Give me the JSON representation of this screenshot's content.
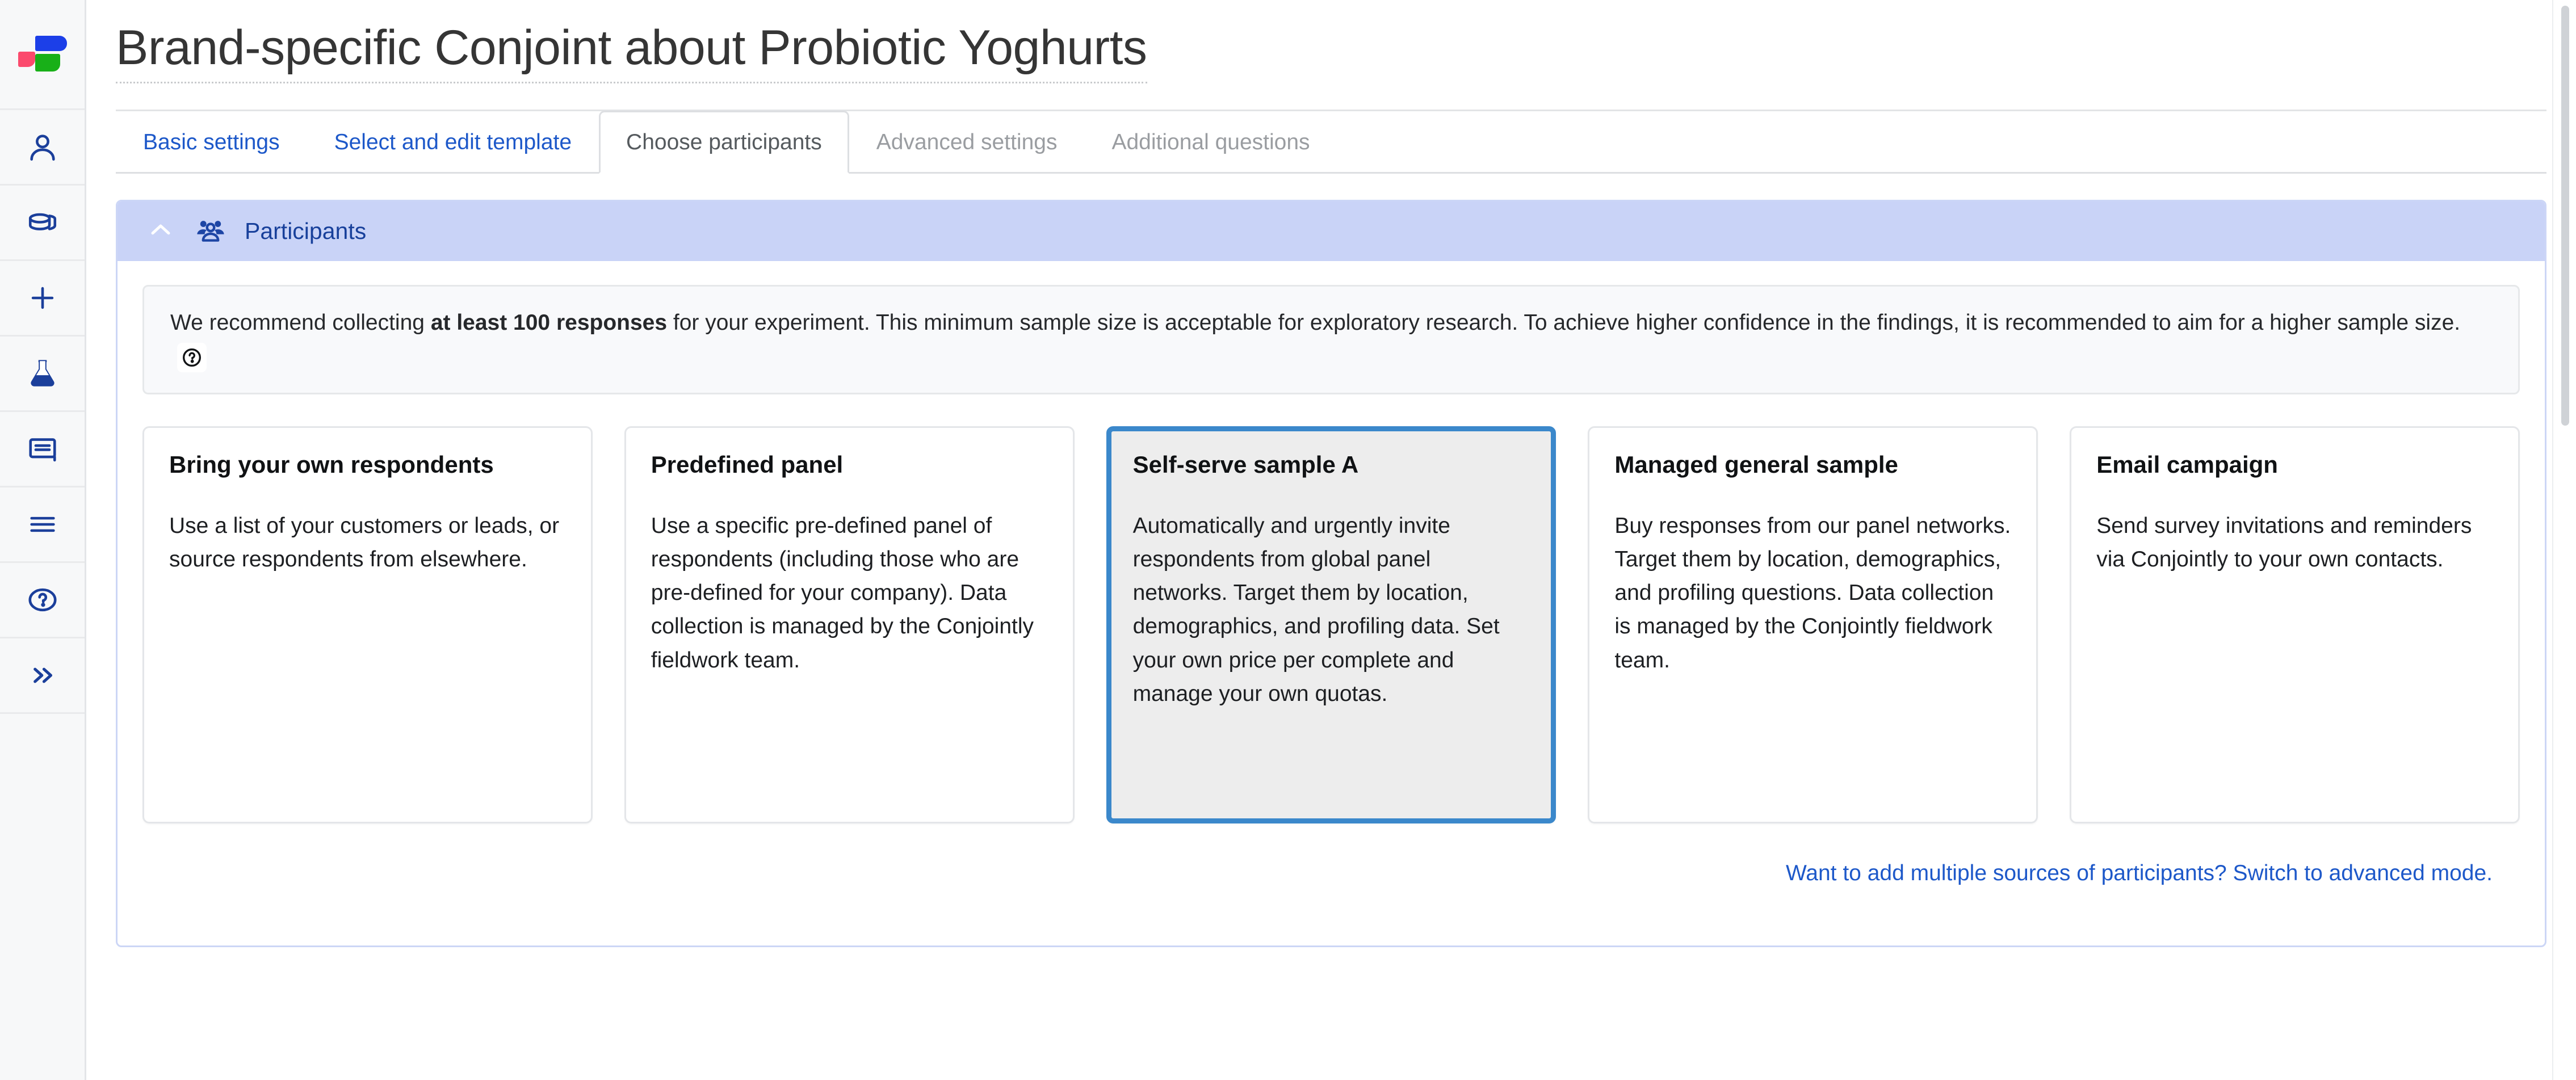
{
  "brand": {
    "logo_name": "conjointly-logo",
    "colors": {
      "blue": "#1c3fe8",
      "pink": "#fb4a6d",
      "green": "#18b018",
      "link": "#1d58c9",
      "selected_border": "#3b88cb",
      "panel_header_bg": "#c9d3f7"
    }
  },
  "sidebar": {
    "items": [
      {
        "icon": "user-icon",
        "label": "Account"
      },
      {
        "icon": "database-stack-icon",
        "label": "Projects"
      },
      {
        "icon": "plus-icon",
        "label": "New"
      },
      {
        "icon": "flask-icon",
        "label": "Experiments"
      },
      {
        "icon": "book-icon",
        "label": "Library"
      },
      {
        "icon": "hamburger-menu-icon",
        "label": "Menu"
      },
      {
        "icon": "question-circle-icon",
        "label": "Help"
      },
      {
        "icon": "chevrons-right-icon",
        "label": "Expand"
      }
    ]
  },
  "header": {
    "title": "Brand-specific Conjoint about Probiotic Yoghurts"
  },
  "tabs": [
    {
      "label": "Basic settings",
      "state": "link"
    },
    {
      "label": "Select and edit template",
      "state": "link"
    },
    {
      "label": "Choose participants",
      "state": "active"
    },
    {
      "label": "Advanced settings",
      "state": "disabled"
    },
    {
      "label": "Additional questions",
      "state": "disabled"
    }
  ],
  "panel": {
    "title": "Participants",
    "collapse_icon": "chevron-up-icon",
    "group_icon": "users-group-icon",
    "notice": {
      "text_before": "We recommend collecting ",
      "text_bold": "at least 100 responses",
      "text_after": " for your experiment. This minimum sample size is acceptable for exploratory research. To achieve higher confidence in the findings, it is recommended to aim for a higher sample size.",
      "help_icon": "question-circle-icon"
    },
    "options": [
      {
        "title": "Bring your own respondents",
        "description": "Use a list of your customers or leads, or source respondents from elsewhere.",
        "selected": false
      },
      {
        "title": "Predefined panel",
        "description": "Use a specific pre-defined panel of respondents (including those who are pre-defined for your company). Data collection is managed by the Conjointly fieldwork team.",
        "selected": false
      },
      {
        "title": "Self-serve sample A",
        "description": "Automatically and urgently invite respondents from global panel networks. Target them by location, demographics, and profiling data. Set your own price per complete and manage your own quotas.",
        "selected": true
      },
      {
        "title": "Managed general sample",
        "description": "Buy responses from our panel networks. Target them by location, demographics, and profiling questions. Data collection is managed by the Conjointly fieldwork team.",
        "selected": false
      },
      {
        "title": "Email campaign",
        "description": "Send survey invitations and reminders via Conjointly to your own contacts.",
        "selected": false
      }
    ],
    "advanced_link": "Want to add multiple sources of participants? Switch to advanced mode."
  }
}
